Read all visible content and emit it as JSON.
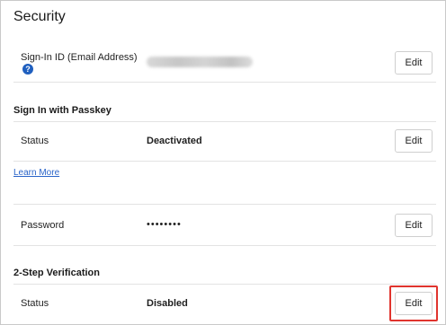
{
  "page": {
    "title": "Security"
  },
  "signin_id": {
    "label": "Sign-In ID (Email Address)",
    "help_icon": "question-circle-icon",
    "edit_label": "Edit"
  },
  "passkey": {
    "heading": "Sign In with Passkey",
    "status_label": "Status",
    "status_value": "Deactivated",
    "edit_label": "Edit",
    "learn_more": "Learn More"
  },
  "password": {
    "label": "Password",
    "value": "••••••••",
    "edit_label": "Edit"
  },
  "two_step": {
    "heading": "2-Step Verification",
    "status_label": "Status",
    "status_value": "Disabled",
    "edit_label": "Edit"
  },
  "colors": {
    "link": "#2a64c9",
    "help_icon": "#1f5fbf",
    "highlight": "#e0342e"
  }
}
